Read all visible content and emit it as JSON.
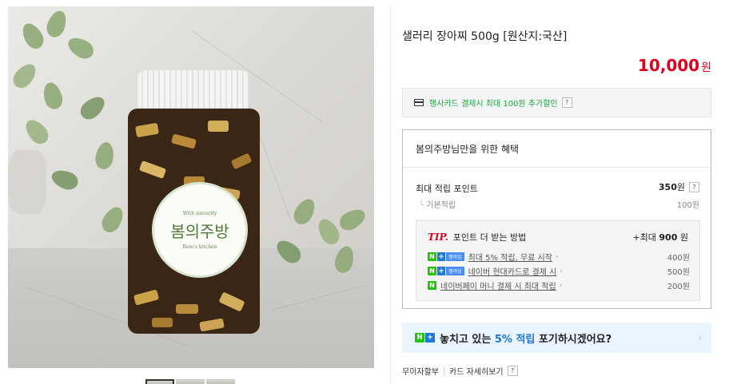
{
  "product": {
    "title": "샐러리 장아찌 500g [원산지:국산]",
    "price": "10,000",
    "currency": "원"
  },
  "card_banner": {
    "text": "행사카드 결제시 최대 100원 추가할인",
    "help": "?"
  },
  "benefit": {
    "title": "봄의주방님만을 위한 혜택",
    "max_points_label": "최대 적립 포인트",
    "max_points_value": "350",
    "max_points_unit": "원",
    "help": "?",
    "base_label": "기본적립",
    "base_value": "100원"
  },
  "tip": {
    "word": "TIP.",
    "title": "포인트 더 받는 방법",
    "max_prefix": "+최대 ",
    "max_value": "900",
    "max_unit": " 원",
    "badge_n": "N",
    "badge_plus": "+",
    "badge_member": "멤버십",
    "rows": [
      {
        "text": "최대 5% 적립, 무료 시작",
        "amount": "400원",
        "icon": "naver-plus-membership-icon"
      },
      {
        "text": "네이버 현대카드로 결제 시",
        "amount": "500원",
        "icon": "naver-plus-membership-icon"
      },
      {
        "text": "네이버페이 머니 결제 시 최대 적립",
        "amount": "200원",
        "icon": "naver-pay-icon"
      }
    ],
    "chevron": "›"
  },
  "promo": {
    "pre": "놓치고 있는 ",
    "highlight": "5% 적립",
    "post": " 포기하시겠어요?",
    "chevron": "›"
  },
  "links": {
    "installment": "무이자할부",
    "card_detail": "카드 자세히보기",
    "help": "?"
  },
  "jar_label": {
    "top": "With sincerity",
    "brand": "봄의주방",
    "bottom": "Bom's kitchen"
  },
  "colors": {
    "price_red": "#e2001a",
    "naver_green": "#1ec800",
    "naver_blue": "#1f78d1",
    "card_green": "#1aa93e"
  }
}
